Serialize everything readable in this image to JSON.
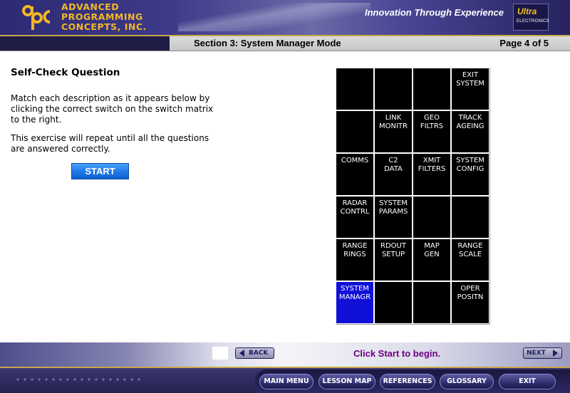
{
  "header": {
    "company_lines": [
      "ADVANCED",
      "PROGRAMMING",
      "CONCEPTS, INC."
    ],
    "tagline": "Innovation Through Experience",
    "brand_main": "Ultra",
    "brand_sub": "ELECTRONICS"
  },
  "section_bar": {
    "title": "Section 3: System Manager Mode",
    "page": "Page 4 of 5"
  },
  "content": {
    "question_title": "Self-Check Question",
    "instruction": "Match each description as it appears below by clicking the correct switch on the switch matrix to the right.",
    "repeat_note": "This exercise will repeat until all the questions are answered correctly.",
    "start_label": "START"
  },
  "matrix": {
    "rows": [
      [
        [],
        [],
        [],
        [
          "EXIT",
          "SYSTEM"
        ]
      ],
      [
        [],
        [
          "LINK",
          "MONITR"
        ],
        [
          "GEO",
          "FILTRS"
        ],
        [
          "TRACK",
          "AGEING"
        ]
      ],
      [
        [
          "COMMS"
        ],
        [
          "C2",
          "DATA"
        ],
        [
          "XMIT",
          "FILTERS"
        ],
        [
          "SYSTEM",
          "CONFIG"
        ]
      ],
      [
        [
          "RADAR",
          "CONTRL"
        ],
        [
          "SYSTEM",
          "PARAMS"
        ],
        [],
        []
      ],
      [
        [
          "RANGE",
          "RINGS"
        ],
        [
          "RDOUT",
          "SETUP"
        ],
        [
          "MAP",
          "GEN"
        ],
        [
          "RANGE",
          "SCALE"
        ]
      ],
      [
        [
          "SYSTEM",
          "MANAGR"
        ],
        [],
        [],
        [
          "OPER",
          "POSITN"
        ]
      ]
    ],
    "selected": "SYSTEM MANAGR",
    "colors": {
      "cell": "#000000",
      "selected": "#1010d8",
      "text": "#ffffff"
    }
  },
  "nav": {
    "back_label": "BACK",
    "next_label": "NEXT",
    "hint": "Click Start to begin."
  },
  "footer_menu": {
    "main_menu": "MAIN MENU",
    "lesson_map": "LESSON MAP",
    "references": "REFERENCES",
    "glossary": "GLOSSARY",
    "exit": "EXIT"
  },
  "colors": {
    "accent_gold": "#f2b826",
    "hint_purple": "#6a0080",
    "start_blue": "#1f78e6",
    "header_navy": "#2d2a72"
  }
}
